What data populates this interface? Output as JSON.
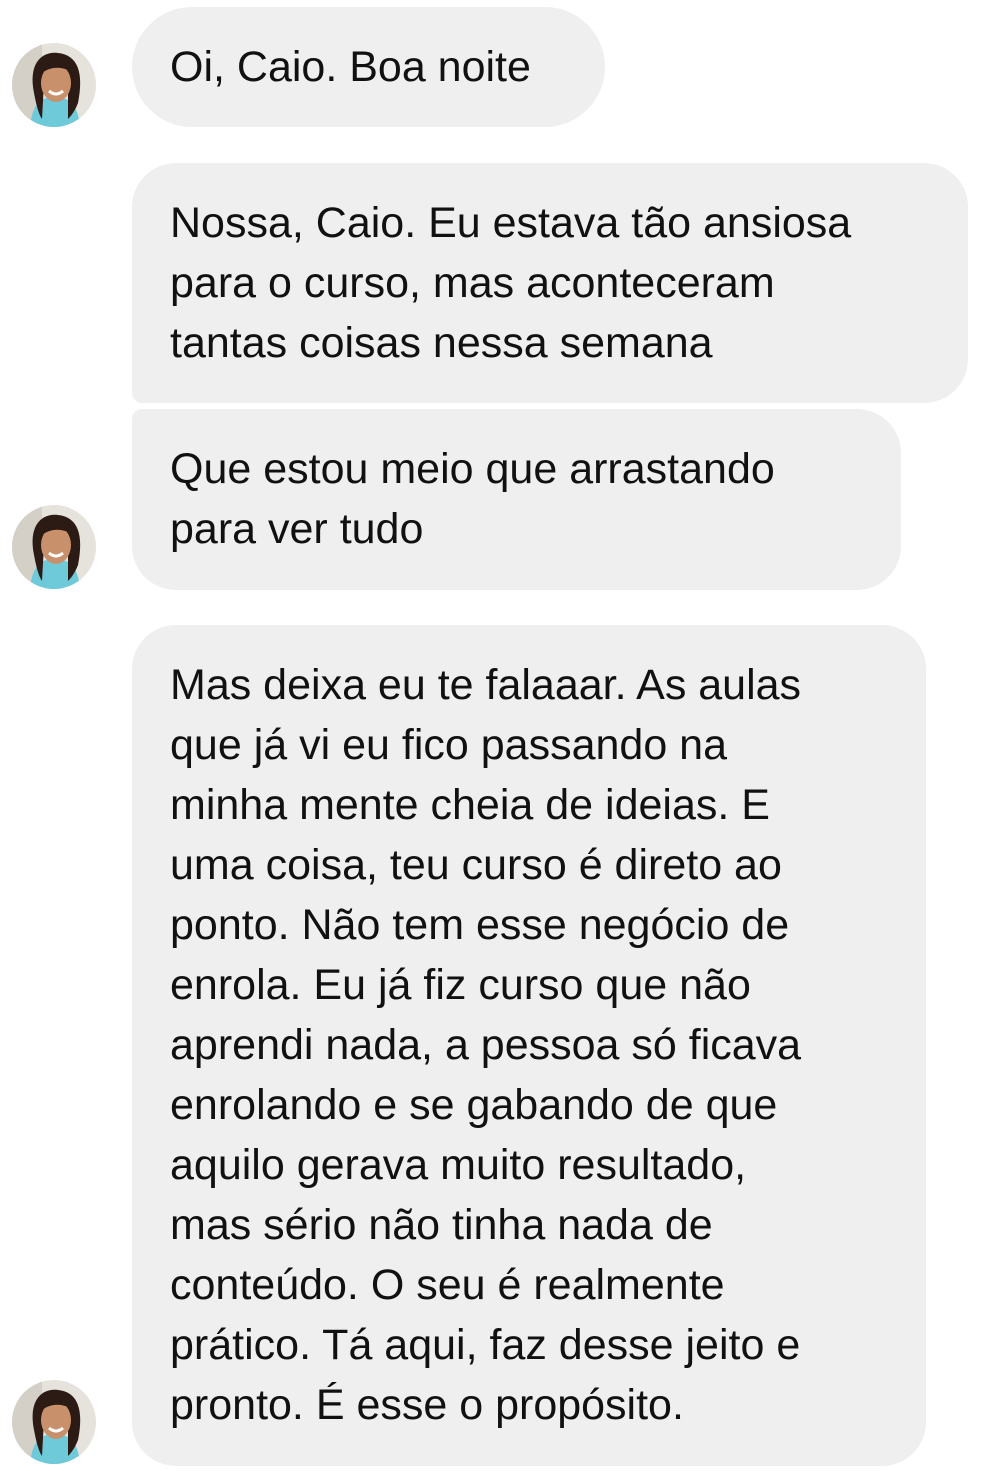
{
  "conversation": {
    "messages": [
      {
        "text": "Oi, Caio. Boa noite"
      },
      {
        "text": "Nossa, Caio. Eu estava tão ansiosa\npara o curso, mas aconteceram\ntantas coisas nessa semana"
      },
      {
        "text": "Que estou meio que arrastando\npara ver tudo"
      },
      {
        "text": "Mas deixa eu te falaaar. As aulas\nque já vi eu fico passando na\nminha mente cheia de ideias. E\numa coisa, teu curso é direto ao\nponto. Não tem esse negócio de\nenrola. Eu já fiz curso que não\naprendi nada, a pessoa só ficava\nenrolando e se gabando de que\naquilo gerava muito resultado,\nmas sério não tinha nada de\nconteúdo. O seu é realmente\nprático. Tá aqui, faz desse jeito e\npronto. É esse o propósito."
      }
    ]
  },
  "colors": {
    "bubble_background": "#efefef",
    "text": "#111111",
    "page_background": "#ffffff"
  }
}
